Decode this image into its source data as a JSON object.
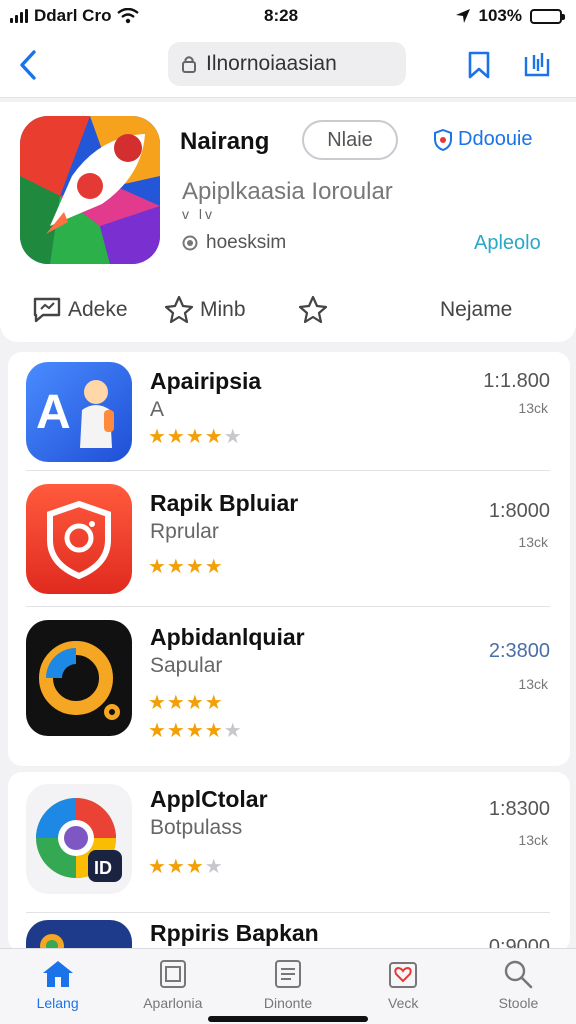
{
  "status": {
    "carrier": "Ddarl Cro",
    "time": "8:28",
    "battery": "103%"
  },
  "nav": {
    "search_text": "Ilnornoiaasian"
  },
  "detail": {
    "app_name": "Nairang",
    "mode_label": "Nlaie",
    "download_label": "Ddoouie",
    "subtitle": "Apiplkaasia Ioroular",
    "tiny_text": "v lv",
    "developer": "hoesksim",
    "open_label": "Apleolo",
    "actions": [
      {
        "label": "Adeke",
        "icon": "chat-icon"
      },
      {
        "label": "Minb",
        "icon": "star-badge-icon"
      },
      {
        "label": "",
        "icon": "star-outline-icon"
      },
      {
        "label": "Nejame",
        "icon": ""
      }
    ]
  },
  "apps": [
    {
      "title": "Apairipsia",
      "subtitle": "A",
      "rating": 4,
      "count": "1:1.800",
      "count_sub": "13ck",
      "icon": "a-letter-icon"
    },
    {
      "title": "Rapik Bpluiar",
      "subtitle": "Rprular",
      "rating": 4,
      "count": "1:8000",
      "count_sub": "13ck",
      "icon": "shield-camera-icon"
    },
    {
      "title": "Apbidanlquiar",
      "subtitle": "Sapular",
      "rating": 4,
      "count": "2:3800",
      "count_sub": "13ck",
      "icon": "donut-icon"
    },
    {
      "title": "ApplCtolar",
      "subtitle": "Botpulass",
      "rating": 3,
      "count": "1:8300",
      "count_sub": "13ck",
      "icon": "browser-icon"
    },
    {
      "title": "Rppiris Bapkan",
      "subtitle": "",
      "rating": 0,
      "count": "0:9000",
      "count_sub": "",
      "icon": "map-icon"
    }
  ],
  "tabs": [
    {
      "label": "Lelang",
      "icon": "home-icon",
      "active": true
    },
    {
      "label": "Aparlonia",
      "icon": "apps-icon",
      "active": false
    },
    {
      "label": "Dinonte",
      "icon": "document-icon",
      "active": false
    },
    {
      "label": "Veck",
      "icon": "heart-icon",
      "active": false
    },
    {
      "label": "Stoole",
      "icon": "search-icon",
      "active": false
    }
  ],
  "colors": {
    "accent": "#1a73e8",
    "star": "#f2a007",
    "open": "#29a8c8"
  }
}
